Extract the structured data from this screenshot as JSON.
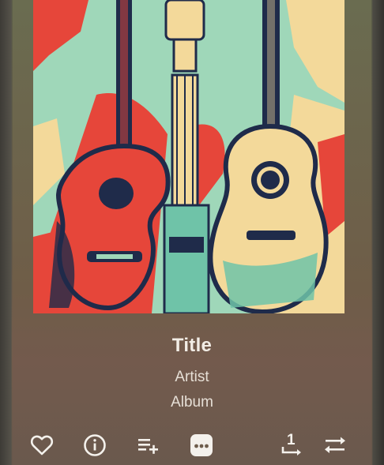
{
  "track": {
    "title": "Title",
    "artist": "Artist",
    "album": "Album"
  },
  "controls": {
    "queue_number": "1"
  },
  "icons": {
    "favorite": "heart-outline-icon",
    "info": "info-circle-icon",
    "add_to_playlist": "playlist-add-icon",
    "more": "more-horizontal-icon",
    "repeat_one": "repeat-one-icon",
    "shuffle": "shuffle-icon"
  },
  "colors": {
    "text_primary": "#f2ede6",
    "icon": "#f4f1ec",
    "art_mint": "#9fd7b9",
    "art_red": "#e6463a",
    "art_navy": "#1f2b4a",
    "art_cream": "#f3d99a"
  }
}
